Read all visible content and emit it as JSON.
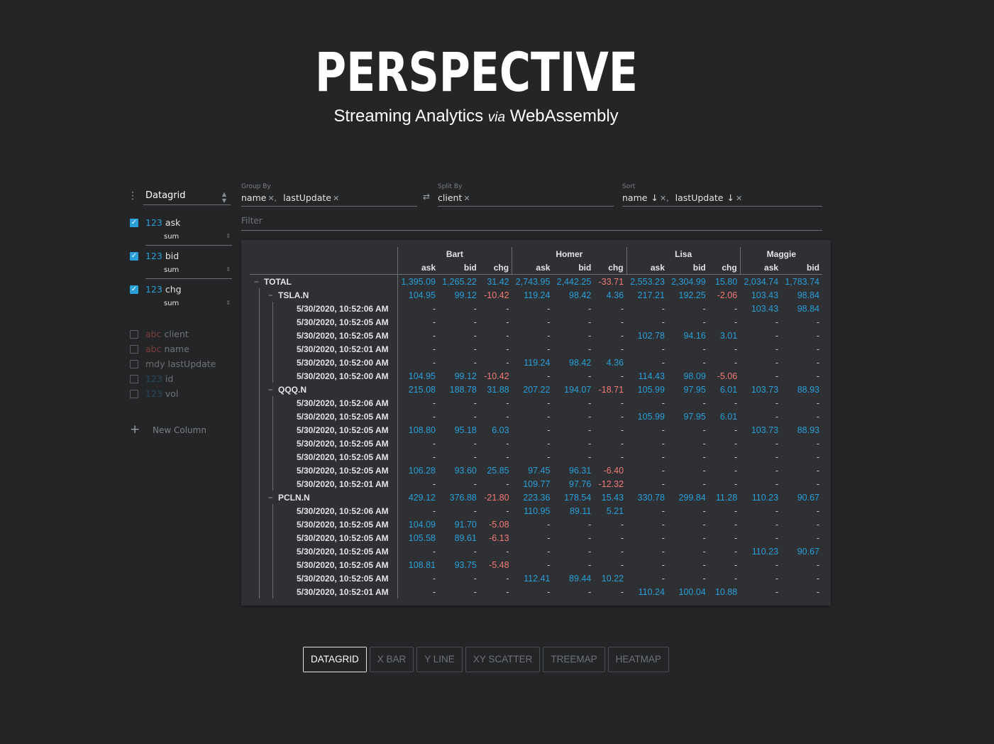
{
  "header": {
    "logo_text": "PERSPECTIVE",
    "tagline_part1": "Streaming Analytics",
    "tagline_via": "via",
    "tagline_part2": "WebAssembly"
  },
  "sidebar": {
    "plugin": "Datagrid",
    "active_columns": [
      {
        "type": "123",
        "name": "ask",
        "aggregate": "sum",
        "checked": true
      },
      {
        "type": "123",
        "name": "bid",
        "aggregate": "sum",
        "checked": true
      },
      {
        "type": "123",
        "name": "chg",
        "aggregate": "sum",
        "checked": true
      }
    ],
    "inactive_columns": [
      {
        "type": "abc",
        "name": "client"
      },
      {
        "type": "abc",
        "name": "name"
      },
      {
        "type": "mdy",
        "name": "lastUpdate"
      },
      {
        "type": "123",
        "name": "id"
      },
      {
        "type": "123",
        "name": "vol"
      }
    ],
    "new_column_label": "New Column"
  },
  "pivots": {
    "group_by": {
      "label": "Group By",
      "values": [
        "name",
        "lastUpdate"
      ]
    },
    "split_by": {
      "label": "Split By",
      "values": [
        "client"
      ]
    },
    "sort": {
      "label": "Sort",
      "values": [
        "name",
        "lastUpdate"
      ]
    },
    "filter_placeholder": "Filter"
  },
  "grid": {
    "column_groups": [
      "Bart",
      "Homer",
      "Lisa",
      "Maggie"
    ],
    "subcolumns": [
      "ask",
      "bid",
      "chg"
    ],
    "rows": [
      {
        "level": 0,
        "label": "TOTAL",
        "toggle": "−",
        "values": [
          "1,395.09",
          "1,265.22",
          "31.42",
          "2,743.95",
          "2,442.25",
          "-33.71",
          "2,553.23",
          "2,304.99",
          "15.80",
          "2,034.74",
          "1,783.74"
        ]
      },
      {
        "level": 1,
        "label": "TSLA.N",
        "toggle": "−",
        "values": [
          "104.95",
          "99.12",
          "-10.42",
          "119.24",
          "98.42",
          "4.36",
          "217.21",
          "192.25",
          "-2.06",
          "103.43",
          "98.84"
        ]
      },
      {
        "level": 2,
        "label": "5/30/2020, 10:52:06 AM",
        "values": [
          "-",
          "-",
          "-",
          "-",
          "-",
          "-",
          "-",
          "-",
          "-",
          "103.43",
          "98.84"
        ]
      },
      {
        "level": 2,
        "label": "5/30/2020, 10:52:05 AM",
        "values": [
          "-",
          "-",
          "-",
          "-",
          "-",
          "-",
          "-",
          "-",
          "-",
          "-",
          "-"
        ]
      },
      {
        "level": 2,
        "label": "5/30/2020, 10:52:05 AM",
        "values": [
          "-",
          "-",
          "-",
          "-",
          "-",
          "-",
          "102.78",
          "94.16",
          "3.01",
          "-",
          "-"
        ]
      },
      {
        "level": 2,
        "label": "5/30/2020, 10:52:01 AM",
        "values": [
          "-",
          "-",
          "-",
          "-",
          "-",
          "-",
          "-",
          "-",
          "-",
          "-",
          "-"
        ]
      },
      {
        "level": 2,
        "label": "5/30/2020, 10:52:00 AM",
        "values": [
          "-",
          "-",
          "-",
          "119.24",
          "98.42",
          "4.36",
          "-",
          "-",
          "-",
          "-",
          "-"
        ]
      },
      {
        "level": 2,
        "label": "5/30/2020, 10:52:00 AM",
        "values": [
          "104.95",
          "99.12",
          "-10.42",
          "-",
          "-",
          "-",
          "114.43",
          "98.09",
          "-5.06",
          "-",
          "-"
        ]
      },
      {
        "level": 1,
        "label": "QQQ.N",
        "toggle": "−",
        "values": [
          "215.08",
          "188.78",
          "31.88",
          "207.22",
          "194.07",
          "-18.71",
          "105.99",
          "97.95",
          "6.01",
          "103.73",
          "88.93"
        ]
      },
      {
        "level": 2,
        "label": "5/30/2020, 10:52:06 AM",
        "values": [
          "-",
          "-",
          "-",
          "-",
          "-",
          "-",
          "-",
          "-",
          "-",
          "-",
          "-"
        ]
      },
      {
        "level": 2,
        "label": "5/30/2020, 10:52:05 AM",
        "values": [
          "-",
          "-",
          "-",
          "-",
          "-",
          "-",
          "105.99",
          "97.95",
          "6.01",
          "-",
          "-"
        ]
      },
      {
        "level": 2,
        "label": "5/30/2020, 10:52:05 AM",
        "values": [
          "108.80",
          "95.18",
          "6.03",
          "-",
          "-",
          "-",
          "-",
          "-",
          "-",
          "103.73",
          "88.93"
        ]
      },
      {
        "level": 2,
        "label": "5/30/2020, 10:52:05 AM",
        "values": [
          "-",
          "-",
          "-",
          "-",
          "-",
          "-",
          "-",
          "-",
          "-",
          "-",
          "-"
        ]
      },
      {
        "level": 2,
        "label": "5/30/2020, 10:52:05 AM",
        "values": [
          "-",
          "-",
          "-",
          "-",
          "-",
          "-",
          "-",
          "-",
          "-",
          "-",
          "-"
        ]
      },
      {
        "level": 2,
        "label": "5/30/2020, 10:52:05 AM",
        "values": [
          "106.28",
          "93.60",
          "25.85",
          "97.45",
          "96.31",
          "-6.40",
          "-",
          "-",
          "-",
          "-",
          "-"
        ]
      },
      {
        "level": 2,
        "label": "5/30/2020, 10:52:01 AM",
        "values": [
          "-",
          "-",
          "-",
          "109.77",
          "97.76",
          "-12.32",
          "-",
          "-",
          "-",
          "-",
          "-"
        ]
      },
      {
        "level": 1,
        "label": "PCLN.N",
        "toggle": "−",
        "values": [
          "429.12",
          "376.88",
          "-21.80",
          "223.36",
          "178.54",
          "15.43",
          "330.78",
          "299.84",
          "11.28",
          "110.23",
          "90.67"
        ]
      },
      {
        "level": 2,
        "label": "5/30/2020, 10:52:06 AM",
        "values": [
          "-",
          "-",
          "-",
          "110.95",
          "89.11",
          "5.21",
          "-",
          "-",
          "-",
          "-",
          "-"
        ]
      },
      {
        "level": 2,
        "label": "5/30/2020, 10:52:05 AM",
        "values": [
          "104.09",
          "91.70",
          "-5.08",
          "-",
          "-",
          "-",
          "-",
          "-",
          "-",
          "-",
          "-"
        ]
      },
      {
        "level": 2,
        "label": "5/30/2020, 10:52:05 AM",
        "values": [
          "105.58",
          "89.61",
          "-6.13",
          "-",
          "-",
          "-",
          "-",
          "-",
          "-",
          "-",
          "-"
        ]
      },
      {
        "level": 2,
        "label": "5/30/2020, 10:52:05 AM",
        "values": [
          "-",
          "-",
          "-",
          "-",
          "-",
          "-",
          "-",
          "-",
          "-",
          "110.23",
          "90.67"
        ]
      },
      {
        "level": 2,
        "label": "5/30/2020, 10:52:05 AM",
        "values": [
          "108.81",
          "93.75",
          "-5.48",
          "-",
          "-",
          "-",
          "-",
          "-",
          "-",
          "-",
          "-"
        ]
      },
      {
        "level": 2,
        "label": "5/30/2020, 10:52:05 AM",
        "values": [
          "-",
          "-",
          "-",
          "112.41",
          "89.44",
          "10.22",
          "-",
          "-",
          "-",
          "-",
          "-"
        ]
      },
      {
        "level": 2,
        "label": "5/30/2020, 10:52:01 AM",
        "values": [
          "-",
          "-",
          "-",
          "-",
          "-",
          "-",
          "110.24",
          "100.04",
          "10.88",
          "-",
          "-"
        ]
      }
    ]
  },
  "plugin_tabs": [
    {
      "label": "DATAGRID",
      "active": true
    },
    {
      "label": "X BAR",
      "active": false
    },
    {
      "label": "Y LINE",
      "active": false
    },
    {
      "label": "XY SCATTER",
      "active": false
    },
    {
      "label": "TREEMAP",
      "active": false
    },
    {
      "label": "HEATMAP",
      "active": false
    }
  ],
  "colors": {
    "background": "#242526",
    "panel": "#2e3033",
    "positive": "#2a9fd8",
    "negative": "#f47a76",
    "text": "#e2e4e6"
  },
  "icons": {
    "menu": "vertical-dots-icon",
    "swap": "swap-arrows-icon",
    "remove": "close-x-icon",
    "sort_desc": "arrow-down-icon",
    "add": "plus-icon",
    "checkbox": "checkmark-icon",
    "collapse": "minus-icon"
  }
}
